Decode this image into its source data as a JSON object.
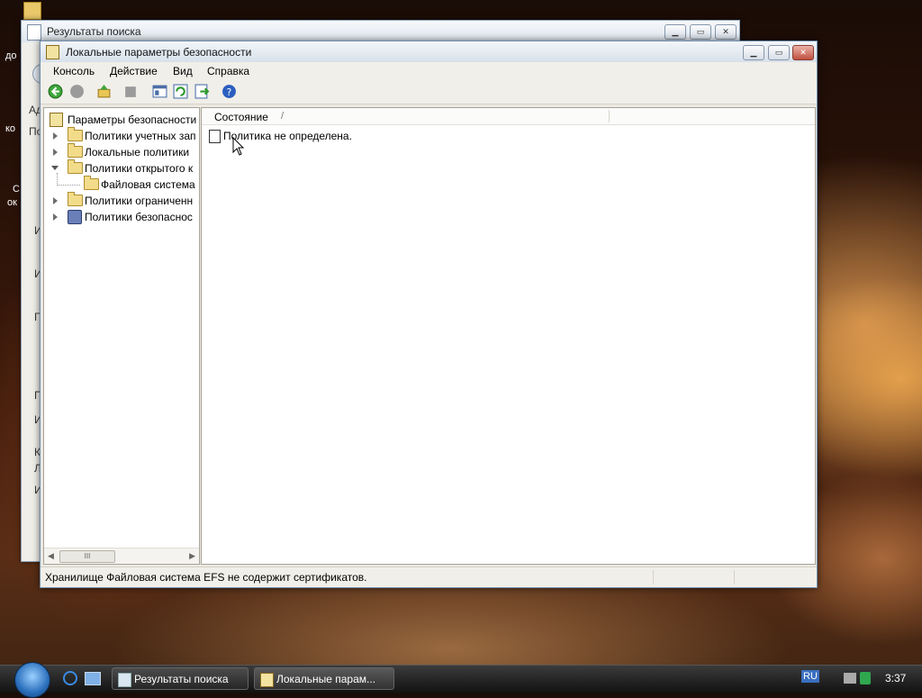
{
  "back_window": {
    "title": "Результаты поиска",
    "sidebar_chars": [
      "Ад",
      "По",
      "И",
      "И",
      "Г",
      "П",
      "И",
      "К",
      "Л",
      "И"
    ]
  },
  "desktop": {
    "fragments": [
      "до",
      "ко",
      "С",
      "ок"
    ]
  },
  "main_window": {
    "title": "Локальные параметры безопасности",
    "menu": [
      "Консоль",
      "Действие",
      "Вид",
      "Справка"
    ],
    "toolbar_icons": [
      "back-icon",
      "forward-icon",
      "up-folder-icon",
      "properties-icon",
      "show-hide-tree-icon",
      "refresh-icon",
      "export-list-icon",
      "help-icon"
    ],
    "tree": [
      {
        "label": "Параметры безопасности",
        "level": 0,
        "icon": "security-settings-icon",
        "expander": "none"
      },
      {
        "label": "Политики учетных зап",
        "level": 1,
        "icon": "folder-icon",
        "expander": "closed"
      },
      {
        "label": "Локальные политики",
        "level": 1,
        "icon": "folder-icon",
        "expander": "closed"
      },
      {
        "label": "Политики открытого к",
        "level": 1,
        "icon": "folder-icon",
        "expander": "open"
      },
      {
        "label": "Файловая система",
        "level": 2,
        "icon": "folder-open-icon",
        "expander": "none"
      },
      {
        "label": "Политики ограниченн",
        "level": 1,
        "icon": "folder-icon",
        "expander": "closed"
      },
      {
        "label": "Политики безопаснос",
        "level": 1,
        "icon": "network-policy-icon",
        "expander": "closed"
      }
    ],
    "scroll_thumb": "III",
    "list_header": "Состояние",
    "sort_indicator": "/",
    "list_items": [
      "Политика не определена."
    ],
    "status_text": "Хранилище Файловая система EFS не содержит сертификатов."
  },
  "taskbar": {
    "buttons": [
      "Результаты поиска",
      "Локальные парам..."
    ],
    "language": "RU",
    "clock": "3:37"
  }
}
